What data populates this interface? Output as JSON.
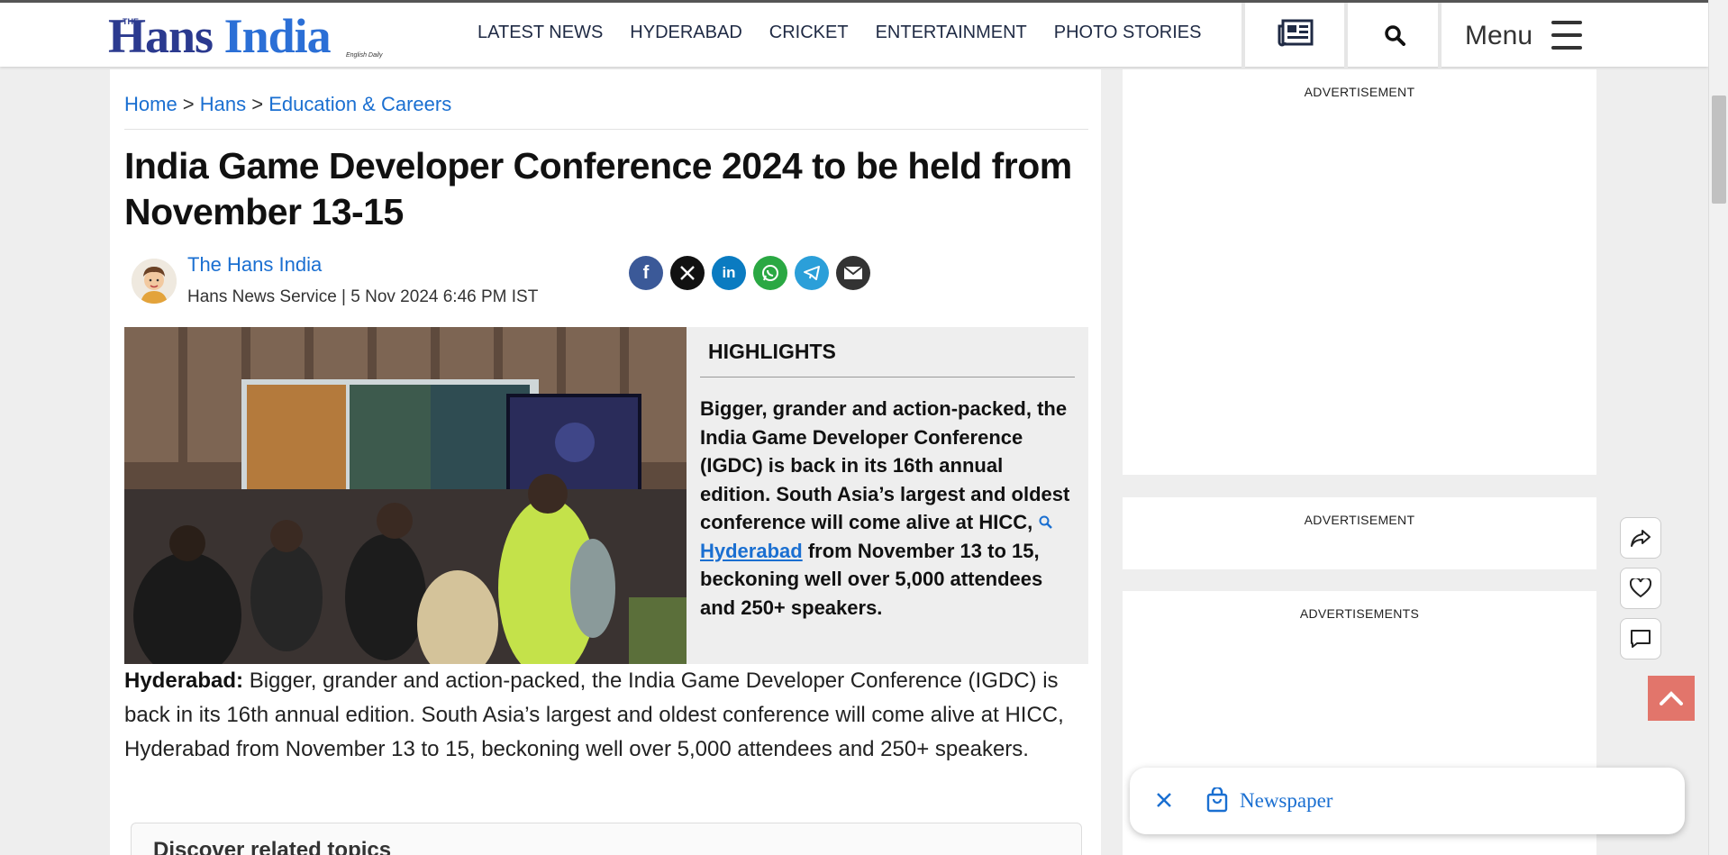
{
  "header": {
    "logo": {
      "the": "THE",
      "name_1": "Hans ",
      "name_2": "India",
      "tagline": "English Daily"
    },
    "nav": [
      "LATEST NEWS",
      "HYDERABAD",
      "CRICKET",
      "ENTERTAINMENT",
      "PHOTO STORIES"
    ],
    "menu_label": "Menu",
    "icons": [
      "epaper-icon",
      "search-icon",
      "hamburger-icon"
    ]
  },
  "breadcrumb": {
    "home": "Home",
    "sep1": " > ",
    "section": "Hans",
    "sep2": " > ",
    "category": "Education & Careers"
  },
  "article": {
    "title": "India Game Developer Conference 2024 to be held from November 13-15",
    "author": "The Hans India",
    "byline": "Hans News Service | 5 Nov 2024 6:46 PM IST",
    "share_icons": [
      "facebook-icon",
      "x-icon",
      "linkedin-icon",
      "whatsapp-icon",
      "telegram-icon",
      "email-icon"
    ],
    "highlights_title": "HIGHLIGHTS",
    "highlights_before": "Bigger, grander and action-packed, the India Game Developer Conference (IGDC) is back in its 16th annual edition. South Asia’s largest and oldest conference will come alive at HICC, ",
    "highlights_link": "Hyderabad",
    "highlights_after": " from November 13 to 15, beckoning well over 5,000 attendees and 250+ speakers.",
    "body_lead": "Hyderabad:",
    "body": " Bigger, grander and action-packed, the India Game Developer Conference (IGDC) is back in its 16th annual edition. South Asia’s largest and oldest conference will come alive at HICC, Hyderabad from November 13 to 15, beckoning well over 5,000 attendees and 250+ speakers.",
    "related_title": "Discover related topics"
  },
  "sidebar": {
    "ad1": "ADVERTISEMENT",
    "ad2": "ADVERTISEMENT",
    "ad3": "ADVERTISEMENTS"
  },
  "floating": {
    "actions": [
      "share-icon",
      "heart-icon",
      "comment-icon"
    ],
    "newspaper_label": "Newspaper"
  },
  "colors": {
    "link": "#1a6fd1",
    "brand": "#2b3a8f",
    "totop": "#e2756b"
  }
}
